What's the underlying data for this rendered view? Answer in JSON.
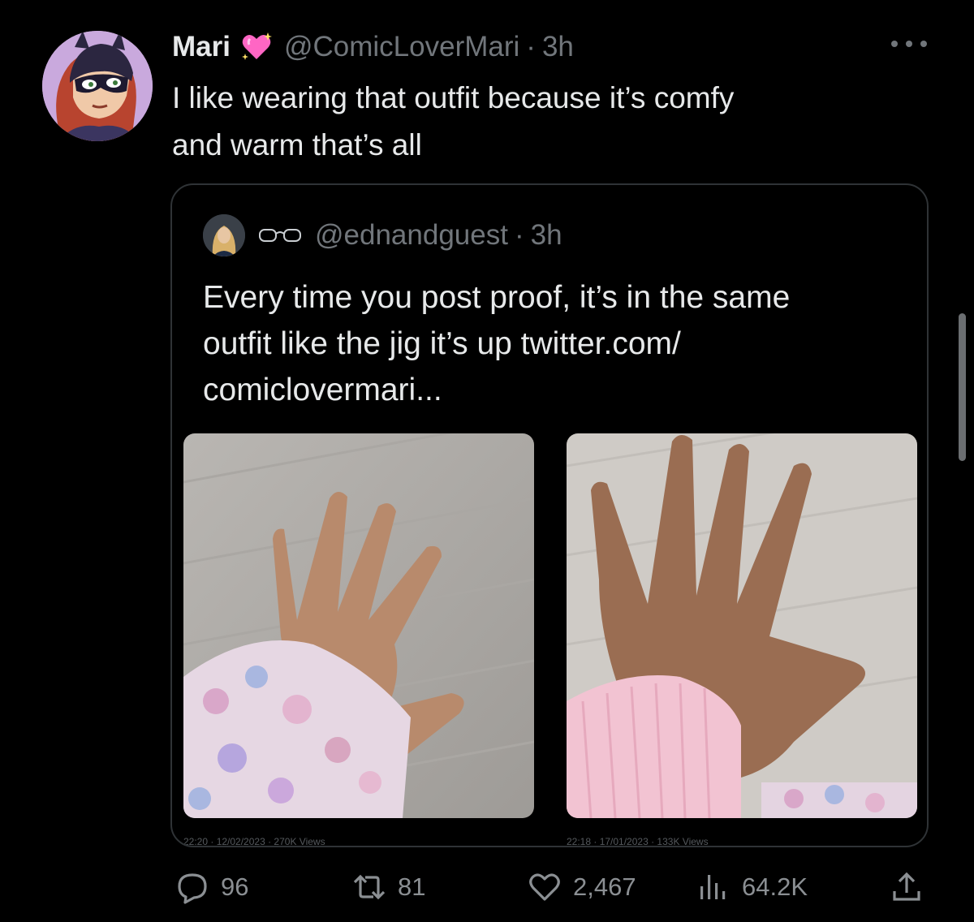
{
  "tweet": {
    "author": {
      "display_name": "Mari",
      "handle": "@ComicLoverMari",
      "separator": "·",
      "time": "3h",
      "badge_icon": "sparkling-heart-icon"
    },
    "text": "I like wearing that outfit because it’s comfy\nand warm that’s all"
  },
  "quoted_tweet": {
    "handle": "@ednandguest",
    "separator": "·",
    "time": "3h",
    "name_icon": "glasses-emoji-icon",
    "text": "Every time you post proof, it’s in the same\noutfit like the jig it’s up twitter.com/\ncomiclovermari...",
    "photos": [
      {
        "alt_icon": "hand-photo",
        "caption": "22:20 · 12/02/2023 · 270K Views"
      },
      {
        "alt_icon": "hand-photo",
        "caption": "22:18 · 17/01/2023 · 133K Views"
      }
    ]
  },
  "actions": {
    "replies": "96",
    "retweets": "81",
    "likes": "2,467",
    "views": "64.2K"
  },
  "colors": {
    "background": "#000000",
    "text_primary": "#e7e9ea",
    "text_secondary": "#71767b",
    "border": "#2f3336"
  }
}
